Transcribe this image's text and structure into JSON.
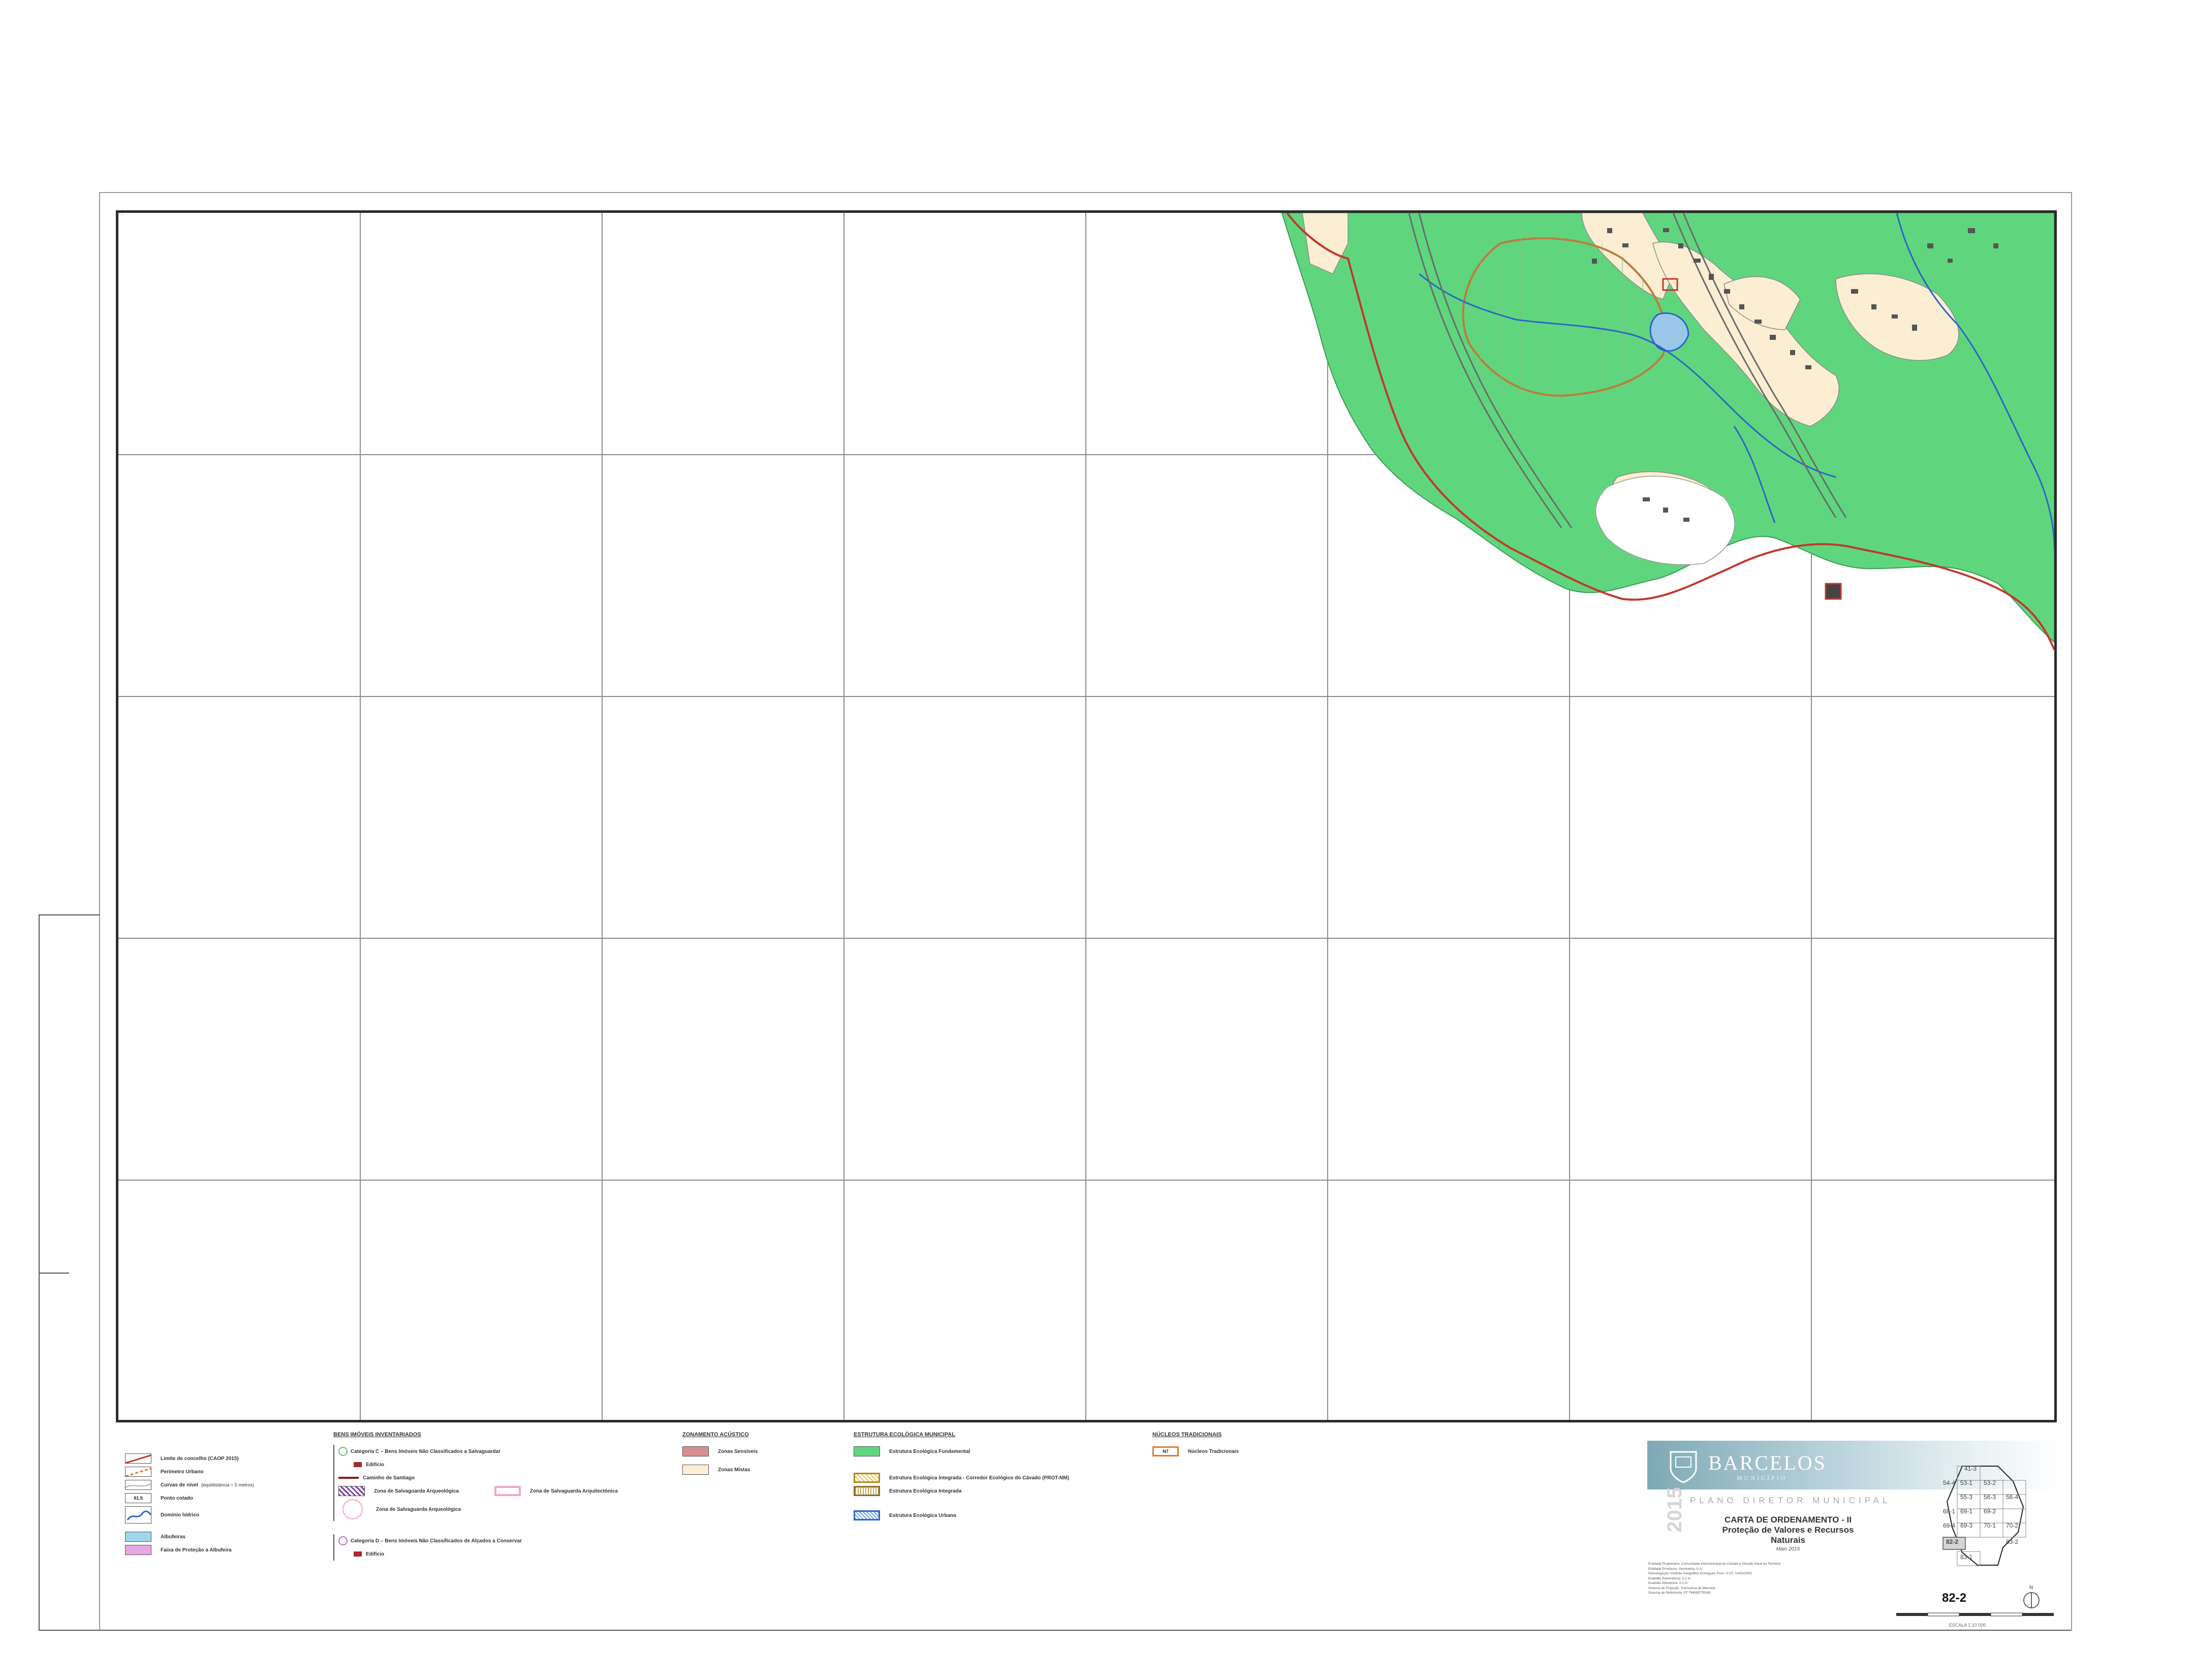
{
  "map": {
    "sheet_id": "82-2",
    "scale_label": "ESCALA 1:10 000",
    "grid": {
      "columns": 8,
      "rows": 5
    },
    "colors": {
      "fundamental": "#5fd67e",
      "urban_fill": "#fbeed2",
      "frame": "#2b2b2b",
      "grid_line": "#8a8a8a",
      "boundary": "#c0392b",
      "watercourse": "#2d64c8",
      "corridor": "#c07a3b"
    }
  },
  "legend": {
    "bens": {
      "title": "BENS IMÓVEIS INVENTARIADOS",
      "items": [
        {
          "label": "Categoria C – Bens Imóveis Não Classificados a Salvaguardar"
        },
        {
          "label": "Edifício"
        },
        {
          "label": "Caminho de Santiago"
        },
        {
          "label": "Zona de Salvaguarda Arqueológica"
        },
        {
          "label": "Zona de Salvaguarda Arquitectónica"
        },
        {
          "label": "Zona de Salvaguarda Arqueológica"
        },
        {
          "label": "Categoria D – Bens Imóveis Não Classificados de Alçados a Conservar"
        },
        {
          "label": "Edifício"
        }
      ]
    },
    "base": {
      "items": [
        {
          "label": "Limite de concelho (CAOP 2015)"
        },
        {
          "label": "Perímetro Urbano"
        },
        {
          "label": "Curvas de nível",
          "note": "(equidistância = 5 metros)"
        },
        {
          "label": "Ponto cotado",
          "symbol_text": "91.5"
        },
        {
          "label": "Domínio hídrico"
        },
        {
          "label": "Albufeiras"
        },
        {
          "label": "Faixa de Proteção a Albufeira"
        }
      ]
    },
    "zonamento": {
      "title": "ZONAMENTO ACÚSTICO",
      "items": [
        {
          "label": "Zonas Sensíveis",
          "color": "#d78e92"
        },
        {
          "label": "Zonas Mistas",
          "color": "#fbeed2"
        }
      ]
    },
    "estrutura": {
      "title": "ESTRUTURA ECOLÓGICA MUNICIPAL",
      "items": [
        {
          "label": "Estrutura Ecológica Fundamental",
          "color": "#5fd67e"
        },
        {
          "label": "Estrutura Ecológica Integrada - Corredor Ecológico do Cávado (PROT-NM)"
        },
        {
          "label": "Estrutura Ecológica Integrada"
        },
        {
          "label": "Estrutura Ecológica Urbana"
        }
      ]
    },
    "nucleos": {
      "title": "NÚCLEOS TRADICIONAIS",
      "items": [
        {
          "label": "Núcleos Tradicionais",
          "symbol_text": "N7"
        }
      ]
    }
  },
  "title_block": {
    "brand": "BARCELOS",
    "brand_sub": "MUNICÍPIO",
    "year": "2015",
    "plan": "PLANO DIRETOR MUNICIPAL",
    "title_line1": "CARTA DE ORDENAMENTO - II",
    "title_line2": "Proteção de Valores e Recursos",
    "title_line3": "Naturais",
    "date": "Maio 2015",
    "fine_print": [
      "Entidade Proprietária: Comunidade Intermunicipal do Cávado e Direção Geral do Território",
      "Entidade Produtora: Geomativa, S.A.",
      "Homologação: Instituto Geográfico Português, Proc. nº 57, 14/03/2008",
      "Exatidão Planimétrica: 0.1 m",
      "Exatidão Altimétrica: 0.2 m",
      "Sistema de Projeção: Transversa de Mercator",
      "Sistema de Referência: PT-TM06/ETRS89"
    ],
    "index_labels": [
      "41-3",
      "53-1",
      "53-2",
      "54-4",
      "55-3",
      "56-3",
      "56-4",
      "68-1",
      "69-1",
      "69-2",
      "69-4",
      "69-3",
      "70-1",
      "70-2",
      "82-2",
      "83-1",
      "83-2"
    ]
  }
}
